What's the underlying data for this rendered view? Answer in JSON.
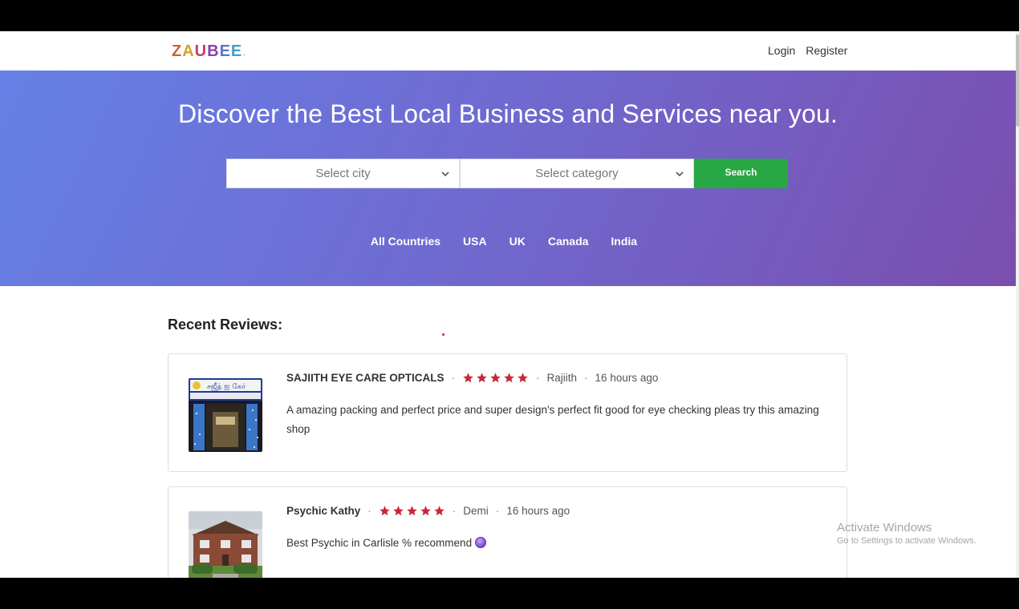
{
  "navbar": {
    "logo": {
      "letters": [
        "Z",
        "A",
        "U",
        "B",
        "E",
        "E"
      ],
      "colors": [
        "#c8632d",
        "#d4a32a",
        "#c23d6b",
        "#8c3fae",
        "#5577c9",
        "#3fa2c9"
      ]
    },
    "login_label": "Login",
    "register_label": "Register"
  },
  "hero": {
    "title": "Discover the Best Local Business and Services near you.",
    "city_select": {
      "selected": "Select city"
    },
    "category_select": {
      "selected": "Select category"
    },
    "search_label": "Search",
    "countries": [
      "All Countries",
      "USA",
      "UK",
      "Canada",
      "India"
    ]
  },
  "reviews": {
    "title": "Recent Reviews:",
    "items": [
      {
        "business": "SAJIITH EYE CARE OPTICALS",
        "rating": 5,
        "reviewer": "Rajiith",
        "time": "16 hours ago",
        "text": "A amazing packing and perfect price and super design's perfect fit good for eye checking pleas try this amazing shop",
        "thumb_sign_text": "சஜீத் ஐ கேர்"
      },
      {
        "business": "Psychic Kathy",
        "rating": 5,
        "reviewer": "Demi",
        "time": "16 hours ago",
        "text": "Best Psychic in Carlisle % recommend",
        "emoji": "crystal-ball-icon"
      }
    ]
  },
  "colors": {
    "star": "#c8283a",
    "search_button": "#28a745",
    "hero_gradient_start": "#6580e6",
    "hero_gradient_end": "#7a4eaf"
  },
  "watermark": {
    "title": "Activate Windows",
    "subtitle": "Go to Settings to activate Windows."
  }
}
